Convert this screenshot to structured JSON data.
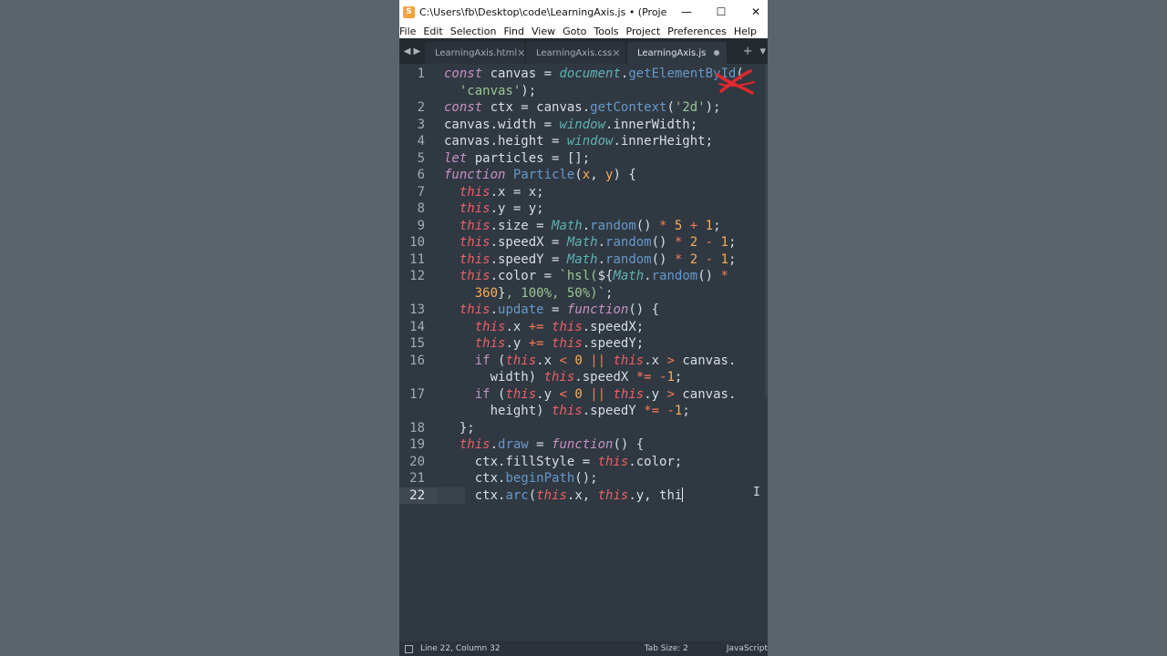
{
  "window": {
    "title": "C:\\Users\\fb\\Desktop\\code\\LearningAxis.js • (Project) - Subli...",
    "app_icon": "sublime-text-icon",
    "controls": {
      "minimize": "—",
      "maximize": "☐",
      "close": "✕"
    }
  },
  "menu": {
    "items": [
      "File",
      "Edit",
      "Selection",
      "Find",
      "View",
      "Goto",
      "Tools",
      "Project",
      "Preferences",
      "Help"
    ]
  },
  "tabs": [
    {
      "label": "LearningAxis.html",
      "state": "close"
    },
    {
      "label": "LearningAxis.css",
      "state": "close"
    },
    {
      "label": "LearningAxis.js",
      "state": "modified",
      "active": true
    }
  ],
  "tab_tools": {
    "add": "+",
    "dropdown": "▾"
  },
  "editor": {
    "current_line": 22,
    "lines": [
      {
        "num": "1",
        "tokens": [
          [
            "kw",
            "const"
          ],
          [
            "p",
            " canvas = "
          ],
          [
            "glob",
            "document"
          ],
          [
            "p",
            "."
          ],
          [
            "fn",
            "getElementById"
          ],
          [
            "p",
            "("
          ]
        ]
      },
      {
        "num": "",
        "tokens": [
          [
            "p",
            "  "
          ],
          [
            "str",
            "'canvas'"
          ],
          [
            "p",
            ");"
          ]
        ]
      },
      {
        "num": "2",
        "tokens": [
          [
            "kw",
            "const"
          ],
          [
            "p",
            " ctx = canvas."
          ],
          [
            "fn",
            "getContext"
          ],
          [
            "p",
            "("
          ],
          [
            "str",
            "'2d'"
          ],
          [
            "p",
            ");"
          ]
        ]
      },
      {
        "num": "3",
        "tokens": [
          [
            "p",
            "canvas.width = "
          ],
          [
            "glob",
            "window"
          ],
          [
            "p",
            ".innerWidth;"
          ]
        ]
      },
      {
        "num": "4",
        "tokens": [
          [
            "p",
            "canvas.height = "
          ],
          [
            "glob",
            "window"
          ],
          [
            "p",
            ".innerHeight;"
          ]
        ]
      },
      {
        "num": "5",
        "tokens": [
          [
            "kw",
            "let"
          ],
          [
            "p",
            " particles = [];"
          ]
        ]
      },
      {
        "num": "6",
        "tokens": [
          [
            "kw",
            "function"
          ],
          [
            "p",
            " "
          ],
          [
            "fn",
            "Particle"
          ],
          [
            "p",
            "("
          ],
          [
            "param",
            "x"
          ],
          [
            "p",
            ", "
          ],
          [
            "param",
            "y"
          ],
          [
            "p",
            ") {"
          ]
        ]
      },
      {
        "num": "7",
        "tokens": [
          [
            "p",
            "  "
          ],
          [
            "this",
            "this"
          ],
          [
            "p",
            ".x = x;"
          ]
        ]
      },
      {
        "num": "8",
        "tokens": [
          [
            "p",
            "  "
          ],
          [
            "this",
            "this"
          ],
          [
            "p",
            ".y = y;"
          ]
        ]
      },
      {
        "num": "9",
        "tokens": [
          [
            "p",
            "  "
          ],
          [
            "this",
            "this"
          ],
          [
            "p",
            ".size = "
          ],
          [
            "glob",
            "Math"
          ],
          [
            "p",
            "."
          ],
          [
            "fn",
            "random"
          ],
          [
            "p",
            "() "
          ],
          [
            "op",
            "*"
          ],
          [
            "p",
            " "
          ],
          [
            "num",
            "5"
          ],
          [
            "p",
            " "
          ],
          [
            "op",
            "+"
          ],
          [
            "p",
            " "
          ],
          [
            "num",
            "1"
          ],
          [
            "p",
            ";"
          ]
        ]
      },
      {
        "num": "10",
        "tokens": [
          [
            "p",
            "  "
          ],
          [
            "this",
            "this"
          ],
          [
            "p",
            ".speedX = "
          ],
          [
            "glob",
            "Math"
          ],
          [
            "p",
            "."
          ],
          [
            "fn",
            "random"
          ],
          [
            "p",
            "() "
          ],
          [
            "op",
            "*"
          ],
          [
            "p",
            " "
          ],
          [
            "num",
            "2"
          ],
          [
            "p",
            " "
          ],
          [
            "op",
            "-"
          ],
          [
            "p",
            " "
          ],
          [
            "num",
            "1"
          ],
          [
            "p",
            ";"
          ]
        ]
      },
      {
        "num": "11",
        "tokens": [
          [
            "p",
            "  "
          ],
          [
            "this",
            "this"
          ],
          [
            "p",
            ".speedY = "
          ],
          [
            "glob",
            "Math"
          ],
          [
            "p",
            "."
          ],
          [
            "fn",
            "random"
          ],
          [
            "p",
            "() "
          ],
          [
            "op",
            "*"
          ],
          [
            "p",
            " "
          ],
          [
            "num",
            "2"
          ],
          [
            "p",
            " "
          ],
          [
            "op",
            "-"
          ],
          [
            "p",
            " "
          ],
          [
            "num",
            "1"
          ],
          [
            "p",
            ";"
          ]
        ]
      },
      {
        "num": "12",
        "tokens": [
          [
            "p",
            "  "
          ],
          [
            "this",
            "this"
          ],
          [
            "p",
            ".color = "
          ],
          [
            "str",
            "`hsl("
          ],
          [
            "p",
            "${"
          ],
          [
            "glob",
            "Math"
          ],
          [
            "p",
            "."
          ],
          [
            "fn",
            "random"
          ],
          [
            "p",
            "() "
          ],
          [
            "op",
            "*"
          ]
        ]
      },
      {
        "num": "",
        "tokens": [
          [
            "p",
            "    "
          ],
          [
            "num",
            "360"
          ],
          [
            "p",
            "}"
          ],
          [
            "str",
            ", 100%, 50%)`"
          ],
          [
            "p",
            ";"
          ]
        ]
      },
      {
        "num": "13",
        "tokens": [
          [
            "p",
            "  "
          ],
          [
            "this",
            "this"
          ],
          [
            "p",
            "."
          ],
          [
            "fn",
            "update"
          ],
          [
            "p",
            " = "
          ],
          [
            "kw",
            "function"
          ],
          [
            "p",
            "() {"
          ]
        ]
      },
      {
        "num": "14",
        "tokens": [
          [
            "p",
            "    "
          ],
          [
            "this",
            "this"
          ],
          [
            "p",
            ".x "
          ],
          [
            "op",
            "+="
          ],
          [
            "p",
            " "
          ],
          [
            "this",
            "this"
          ],
          [
            "p",
            ".speedX;"
          ]
        ]
      },
      {
        "num": "15",
        "tokens": [
          [
            "p",
            "    "
          ],
          [
            "this",
            "this"
          ],
          [
            "p",
            ".y "
          ],
          [
            "op",
            "+="
          ],
          [
            "p",
            " "
          ],
          [
            "this",
            "this"
          ],
          [
            "p",
            ".speedY;"
          ]
        ]
      },
      {
        "num": "16",
        "tokens": [
          [
            "p",
            "    "
          ],
          [
            "ctrl",
            "if"
          ],
          [
            "p",
            " ("
          ],
          [
            "this",
            "this"
          ],
          [
            "p",
            ".x "
          ],
          [
            "op",
            "<"
          ],
          [
            "p",
            " "
          ],
          [
            "num",
            "0"
          ],
          [
            "p",
            " "
          ],
          [
            "op",
            "||"
          ],
          [
            "p",
            " "
          ],
          [
            "this",
            "this"
          ],
          [
            "p",
            ".x "
          ],
          [
            "op",
            ">"
          ],
          [
            "p",
            " canvas."
          ]
        ]
      },
      {
        "num": "",
        "tokens": [
          [
            "p",
            "      width) "
          ],
          [
            "this",
            "this"
          ],
          [
            "p",
            ".speedX "
          ],
          [
            "op",
            "*="
          ],
          [
            "p",
            " "
          ],
          [
            "op",
            "-"
          ],
          [
            "num",
            "1"
          ],
          [
            "p",
            ";"
          ]
        ]
      },
      {
        "num": "17",
        "tokens": [
          [
            "p",
            "    "
          ],
          [
            "ctrl",
            "if"
          ],
          [
            "p",
            " ("
          ],
          [
            "this",
            "this"
          ],
          [
            "p",
            ".y "
          ],
          [
            "op",
            "<"
          ],
          [
            "p",
            " "
          ],
          [
            "num",
            "0"
          ],
          [
            "p",
            " "
          ],
          [
            "op",
            "||"
          ],
          [
            "p",
            " "
          ],
          [
            "this",
            "this"
          ],
          [
            "p",
            ".y "
          ],
          [
            "op",
            ">"
          ],
          [
            "p",
            " canvas."
          ]
        ]
      },
      {
        "num": "",
        "tokens": [
          [
            "p",
            "      height) "
          ],
          [
            "this",
            "this"
          ],
          [
            "p",
            ".speedY "
          ],
          [
            "op",
            "*="
          ],
          [
            "p",
            " "
          ],
          [
            "op",
            "-"
          ],
          [
            "num",
            "1"
          ],
          [
            "p",
            ";"
          ]
        ]
      },
      {
        "num": "18",
        "tokens": [
          [
            "p",
            "  };"
          ]
        ]
      },
      {
        "num": "19",
        "tokens": [
          [
            "p",
            "  "
          ],
          [
            "this",
            "this"
          ],
          [
            "p",
            "."
          ],
          [
            "fn",
            "draw"
          ],
          [
            "p",
            " = "
          ],
          [
            "kw",
            "function"
          ],
          [
            "p",
            "() {"
          ]
        ]
      },
      {
        "num": "20",
        "tokens": [
          [
            "p",
            "    ctx.fillStyle = "
          ],
          [
            "this",
            "this"
          ],
          [
            "p",
            ".color;"
          ]
        ]
      },
      {
        "num": "21",
        "tokens": [
          [
            "p",
            "    ctx."
          ],
          [
            "fn",
            "beginPath"
          ],
          [
            "p",
            "();"
          ]
        ]
      },
      {
        "num": "22",
        "tokens": [
          [
            "p",
            "    ctx."
          ],
          [
            "fn",
            "arc"
          ],
          [
            "p",
            "("
          ],
          [
            "this",
            "this"
          ],
          [
            "p",
            ".x, "
          ],
          [
            "this",
            "this"
          ],
          [
            "p",
            ".y, thi"
          ]
        ],
        "cursor": true
      }
    ]
  },
  "status": {
    "position": "Line 22, Column 32",
    "tab_size": "Tab Size: 2",
    "syntax": "JavaScript",
    "panel_icon": "panel-toggle-icon"
  },
  "colors": {
    "background": "#5b646d",
    "editor_bg": "#303841",
    "tab_bar_bg": "#242a30",
    "annotation_red": "#e0282e"
  }
}
